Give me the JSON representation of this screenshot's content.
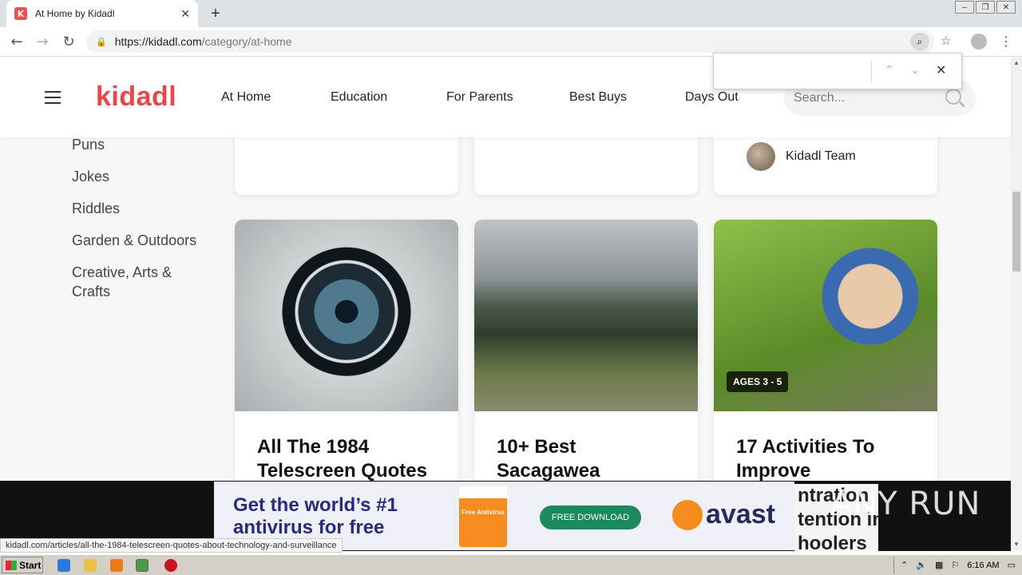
{
  "browser": {
    "tab_title": "At Home by Kidadl",
    "favicon_letter": "K",
    "new_tab_label": "+",
    "url_host": "https://kidadl.com",
    "url_path": "/category/at-home",
    "find_value": ""
  },
  "site": {
    "logo": "kidadl",
    "nav": [
      "At Home",
      "Education",
      "For Parents",
      "Best Buys",
      "Days Out"
    ],
    "search_placeholder": "Search..."
  },
  "sidebar": {
    "items": [
      "Puns",
      "Jokes",
      "Riddles",
      "Garden & Outdoors",
      "Creative, Arts & Crafts"
    ]
  },
  "top_cards": {
    "author": "Kidadl Team"
  },
  "cards": [
    {
      "title": "All The 1984 Telescreen Quotes",
      "image": "camera-lens"
    },
    {
      "title": "10+ Best Sacagawea",
      "image": "mountain-landscape"
    },
    {
      "title": "17 Activities To Improve",
      "image": "kid-bubbles",
      "badge": "AGES 3 - 5"
    }
  ],
  "ad": {
    "headline": "Get the world’s #1 antivirus for free",
    "box_label": "Free Antivirus",
    "button": "FREE DOWNLOAD",
    "brand": "avast",
    "behind_text": "ntration\ntention in\nhoolers"
  },
  "watermark": "ANY RUN",
  "status_url": "kidadl.com/articles/all-the-1984-telescreen-quotes-about-technology-and-surveillance",
  "taskbar": {
    "start": "Start",
    "time": "6:16 AM"
  }
}
